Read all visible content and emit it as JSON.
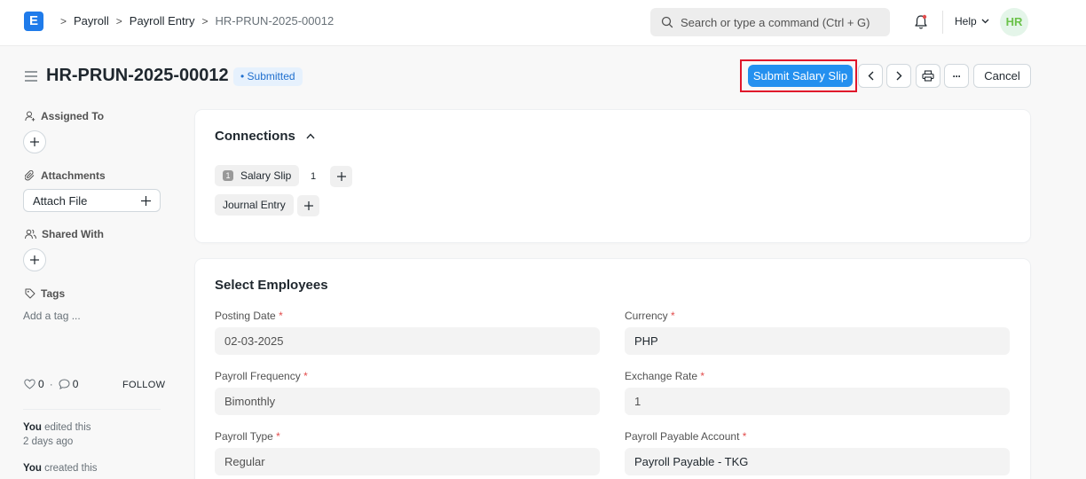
{
  "navbar": {
    "logo_letter": "E",
    "breadcrumbs": [
      "Payroll",
      "Payroll Entry",
      "HR-PRUN-2025-00012"
    ],
    "search_placeholder": "Search or type a command (Ctrl + G)",
    "help_label": "Help",
    "avatar_initials": "HR"
  },
  "header": {
    "title": "HR-PRUN-2025-00012",
    "status": "Submitted",
    "primary_action": "Submit Salary Slip",
    "more_icon": "···",
    "cancel_label": "Cancel"
  },
  "sidebar": {
    "assigned_to_label": "Assigned To",
    "attachments_label": "Attachments",
    "attach_file_label": "Attach File",
    "shared_with_label": "Shared With",
    "tags_label": "Tags",
    "add_tag_placeholder": "Add a tag ...",
    "likes_count": "0",
    "comments_count": "0",
    "dot": "·",
    "follow_label": "FOLLOW",
    "activity": [
      {
        "actor": "You",
        "action": " edited this",
        "time": "2 days ago"
      },
      {
        "actor": "You",
        "action": " created this"
      }
    ]
  },
  "connections": {
    "title": "Connections",
    "items": [
      {
        "badge": "1",
        "label": "Salary Slip",
        "count": "1"
      },
      {
        "label": "Journal Entry"
      }
    ]
  },
  "select_employees": {
    "title": "Select Employees",
    "fields": {
      "posting_date": {
        "label": "Posting Date",
        "value": "02-03-2025"
      },
      "currency": {
        "label": "Currency",
        "value": "PHP"
      },
      "payroll_frequency": {
        "label": "Payroll Frequency",
        "value": "Bimonthly"
      },
      "exchange_rate": {
        "label": "Exchange Rate",
        "value": "1"
      },
      "payroll_type": {
        "label": "Payroll Type",
        "value": "Regular"
      },
      "payroll_payable_account": {
        "label": "Payroll Payable Account",
        "value": "Payroll Payable - TKG"
      }
    },
    "required_mark": "*"
  },
  "colors": {
    "primary": "#2490ef",
    "highlight_border": "#e0162b",
    "status_bg": "#e6f1fd",
    "status_text": "#1f6fce",
    "avatar_bg": "#e4f5e9",
    "avatar_text": "#6bc24a"
  },
  "icons": [
    "app-logo-icon",
    "chevron-right-icon",
    "search-icon",
    "bell-icon",
    "chevron-down-icon",
    "hamburger-icon",
    "chevron-left-icon",
    "printer-icon",
    "more-icon",
    "user-plus-icon",
    "plus-icon",
    "paperclip-icon",
    "users-icon",
    "tag-icon",
    "heart-icon",
    "comment-icon",
    "chevron-up-icon"
  ]
}
